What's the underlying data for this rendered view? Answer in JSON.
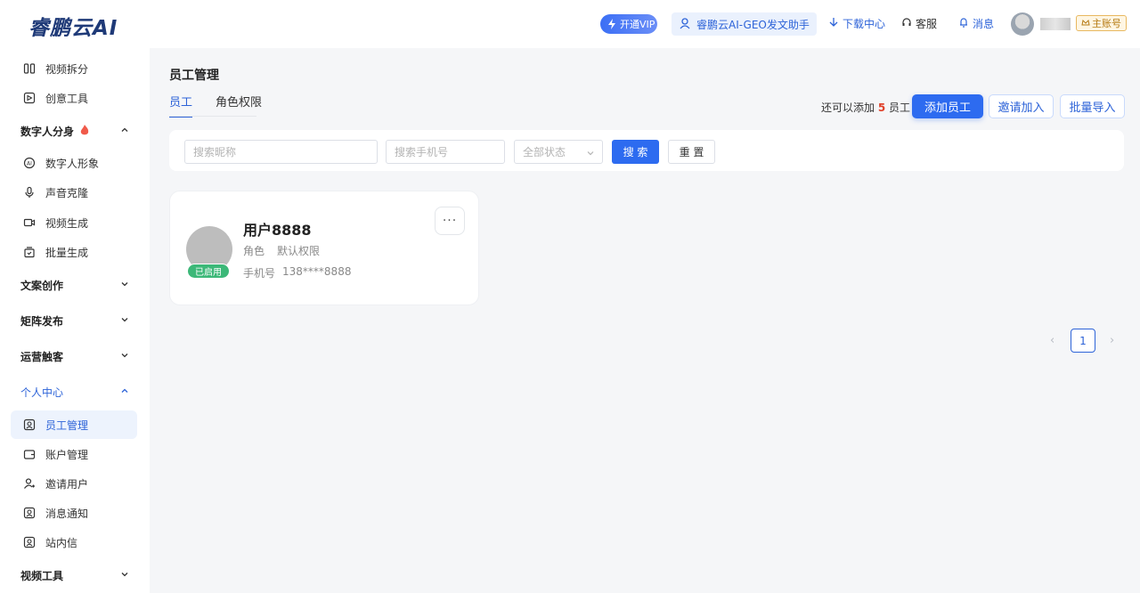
{
  "header": {
    "logo": "睿鹏云AI",
    "vip_label": "开通VIP",
    "geo_label": "睿鹏云AI-GEO发文助手",
    "download_label": "下载中心",
    "service_label": "客服",
    "message_label": "消息",
    "account_badge": "主账号"
  },
  "sidebar": {
    "items_top": [
      {
        "label": "视频拆分",
        "icon": "split-icon"
      },
      {
        "label": "创意工具",
        "icon": "play-edit-icon"
      }
    ],
    "group_digital": "数字人分身",
    "digital_items": [
      {
        "label": "数字人形象",
        "icon": "ai-face-icon"
      },
      {
        "label": "声音克隆",
        "icon": "mic-icon"
      },
      {
        "label": "视频生成",
        "icon": "video-icon"
      },
      {
        "label": "批量生成",
        "icon": "batch-icon"
      }
    ],
    "group_copywriting": "文案创作",
    "group_matrix": "矩阵发布",
    "group_operation": "运营触客",
    "group_personal": "个人中心",
    "personal_items": [
      {
        "label": "员工管理",
        "icon": "staff-icon"
      },
      {
        "label": "账户管理",
        "icon": "wallet-icon"
      },
      {
        "label": "邀请用户",
        "icon": "invite-user-icon"
      },
      {
        "label": "消息通知",
        "icon": "notice-icon"
      },
      {
        "label": "站内信",
        "icon": "mail-icon"
      }
    ],
    "group_video_tools": "视频工具"
  },
  "main": {
    "title": "员工管理",
    "tabs": [
      "员工",
      "角色权限"
    ],
    "quota_prefix": "还可以添加",
    "quota_num": "5",
    "quota_suffix": "员工",
    "add_btn": "添加员工",
    "invite_btn": "邀请加入",
    "import_btn": "批量导入"
  },
  "filters": {
    "nickname_placeholder": "搜索昵称",
    "phone_placeholder": "搜索手机号",
    "status_value": "全部状态",
    "search_btn": "搜 索",
    "reset_btn": "重 置"
  },
  "employee": {
    "name": "用户8888",
    "status": "已启用",
    "role_label": "角色",
    "role_value": "默认权限",
    "phone_label": "手机号",
    "phone_value": "138****8888",
    "more": "···"
  },
  "pagination": {
    "current": "1",
    "prev": "‹",
    "next": "›"
  },
  "colors": {
    "accent": "#2d6bf0",
    "status_enabled": "#3cb878",
    "quota_num": "#e0402a"
  }
}
